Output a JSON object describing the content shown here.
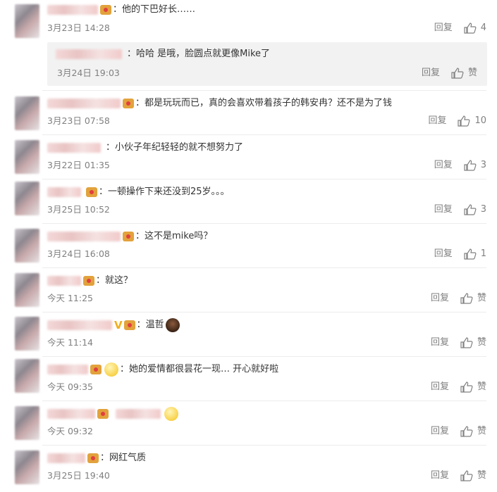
{
  "comments": [
    {
      "text": "他的下巴好长……",
      "time": "3月23日 14:28",
      "reply": "回复",
      "likes": "4"
    },
    {
      "text": "都是玩玩而已，真的会喜欢带着孩子的韩安冉？还不是为了钱",
      "time": "3月23日 07:58",
      "reply": "回复",
      "likes": "10"
    },
    {
      "text": "小伙子年纪轻轻的就不想努力了",
      "time": "3月22日 01:35",
      "reply": "回复",
      "likes": "3"
    },
    {
      "text": "一顿操作下来还没到25岁。。。",
      "time": "3月25日 10:52",
      "reply": "回复",
      "likes": "3"
    },
    {
      "text": "这不是mike吗？",
      "time": "3月24日 16:08",
      "reply": "回复",
      "likes": "1"
    },
    {
      "text": "就这？",
      "time": "今天 11:25",
      "reply": "回复",
      "likes": "赞"
    },
    {
      "text": "温哲",
      "time": "今天 11:14",
      "reply": "回复",
      "likes": "赞"
    },
    {
      "text": "她的爱情都很昙花一现… 开心就好啦",
      "time": "今天 09:35",
      "reply": "回复",
      "likes": "赞"
    },
    {
      "text": "",
      "time": "今天 09:32",
      "reply": "回复",
      "likes": "赞"
    },
    {
      "text": "网红气质",
      "time": "3月25日 19:40",
      "reply": "回复",
      "likes": "赞"
    }
  ],
  "subreply": {
    "text": "哈哈 是哦，脸圆点就更像Mike了",
    "time": "3月24日 19:03",
    "reply": "回复",
    "likes": "赞"
  },
  "colors": {
    "text": "#333333",
    "meta": "#808080",
    "divider": "#ececec",
    "subbg": "#f2f2f2",
    "vip": "#e2a23c",
    "vbadge": "#f3ad1b"
  }
}
